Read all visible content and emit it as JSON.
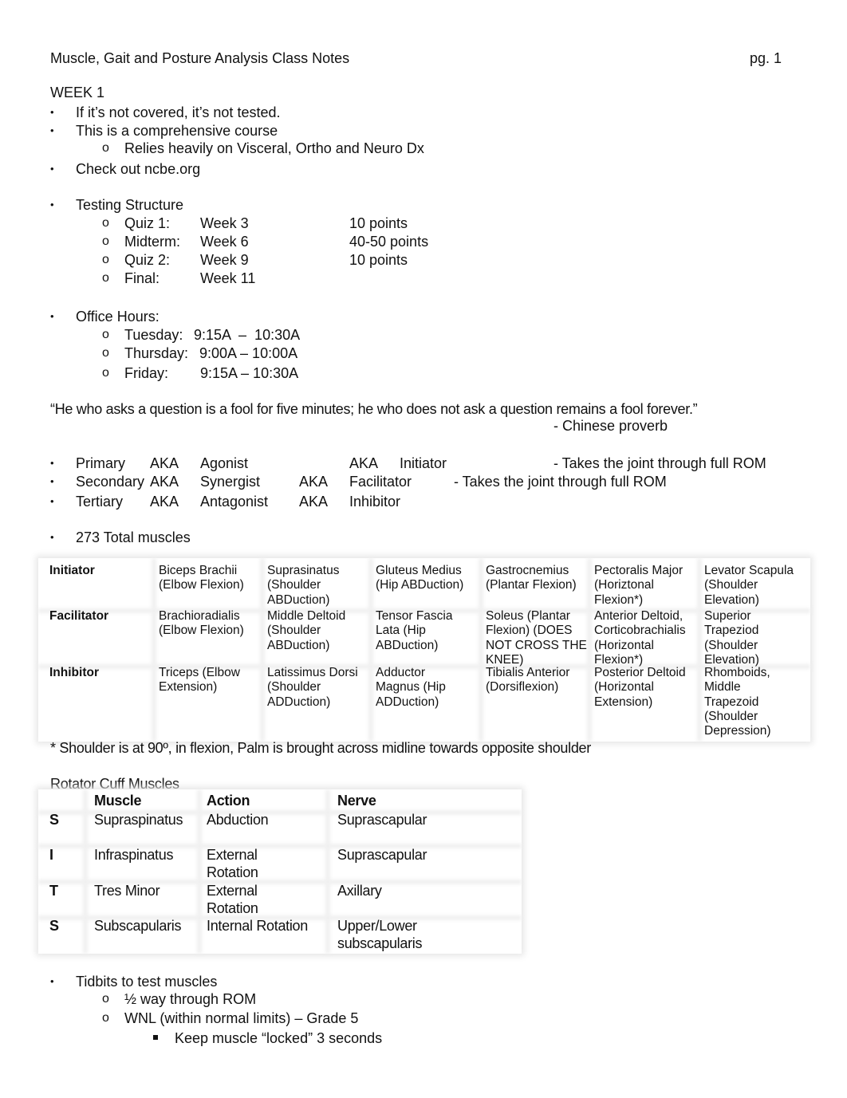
{
  "header": {
    "title": "Muscle, Gait and Posture Analysis Class Notes",
    "page": "pg. 1"
  },
  "week": "WEEK 1",
  "intro_bullets": [
    "If it’s not covered, it’s not tested.",
    "This is a comprehensive course",
    "Check out ncbe.org"
  ],
  "intro_sub": "Relies heavily on Visceral, Ortho and Neuro Dx",
  "testing": {
    "label": "Testing Structure",
    "rows": [
      {
        "name": "Quiz 1:",
        "week": "Week 3",
        "points": "10 points"
      },
      {
        "name": "Midterm:",
        "week": "Week 6",
        "points": "40-50 points"
      },
      {
        "name": "Quiz 2:",
        "week": "Week 9",
        "points": "10 points"
      },
      {
        "name": "Final:",
        "week": "Week 11",
        "points": ""
      }
    ]
  },
  "office_hours": {
    "label": "Office Hours:",
    "rows": [
      {
        "day": "Tuesday:",
        "time": "9:15A  –  10:30A"
      },
      {
        "day": "Thursday:",
        "time": "9:00A – 10:00A"
      },
      {
        "day": "Friday:",
        "time": "9:15A – 10:30A"
      }
    ]
  },
  "quote": {
    "text": "“He who asks a question is a fool for five minutes; he who does not ask a question remains a fool forever.”",
    "attribution": "- Chinese proverb"
  },
  "roles": [
    {
      "a": "Primary",
      "aka1": "AKA",
      "b": "Agonist",
      "aka2": "AKA",
      "c": "Initiator",
      "note": "- Takes the joint through full ROM"
    },
    {
      "a": "Secondary",
      "aka1": "AKA",
      "b": "Synergist",
      "aka2": "AKA",
      "c": "Facilitator",
      "note": "- Takes the joint through full ROM"
    },
    {
      "a": "Tertiary",
      "aka1": "AKA",
      "b": "Antagonist",
      "aka2": "AKA",
      "c": "Inhibitor",
      "note": ""
    }
  ],
  "total_muscles": "273 Total muscles",
  "muscle_table": {
    "rows": [
      {
        "head": "Initiator",
        "cells": [
          "Biceps Brachii (Elbow Flexion)",
          "Suprasinatus (Shoulder ABDuction)",
          "Gluteus Medius (Hip ABDuction)",
          "Gastrocnemius (Plantar Flexion)",
          "Pectoralis Major (Horiztonal Flexion*)",
          "Levator Scapula (Shoulder Elevation)"
        ]
      },
      {
        "head": "Facilitator",
        "cells": [
          "Brachioradialis (Elbow Flexion)",
          "Middle Deltoid (Shoulder ABDuction)",
          "Tensor Fascia Lata (Hip ABDuction)",
          "Soleus (Plantar Flexion) (DOES NOT CROSS THE KNEE)",
          "Anterior Deltoid, Corticobrachialis (Horizontal Flexion*)",
          "Superior Trapeziod (Shoulder Elevation)"
        ]
      },
      {
        "head": "Inhibitor",
        "cells": [
          "Triceps (Elbow Extension)",
          "Latissimus Dorsi (Shoulder ADDuction)",
          "Adductor Magnus (Hip ADDuction)",
          "Tibialis Anterior (Dorsiflexion)",
          "Posterior Deltoid (Horizontal Extension)",
          "Rhomboids, Middle Trapezoid (Shoulder Depression)"
        ]
      }
    ]
  },
  "footnote": "* Shoulder is at 90º, in flexion, Palm is brought across midline towards opposite shoulder",
  "rotator": {
    "title": "Rotator Cuff Muscles",
    "headers": [
      "",
      "Muscle",
      "Action",
      "Nerve"
    ],
    "rows": [
      {
        "letter": "S",
        "muscle": "Supraspinatus",
        "action": "Abduction",
        "nerve": "Suprascapular"
      },
      {
        "letter": "I",
        "muscle": "Infraspinatus",
        "action": "External Rotation",
        "nerve": "Suprascapular"
      },
      {
        "letter": "T",
        "muscle": "Tres Minor",
        "action": "External Rotation",
        "nerve": "Axillary"
      },
      {
        "letter": "S",
        "muscle": "Subscapularis",
        "action": "Internal Rotation",
        "nerve": "Upper/Lower subscapularis"
      }
    ]
  },
  "tidbits": {
    "label": "Tidbits to test muscles",
    "subs": [
      "½ way through ROM",
      "WNL (within normal limits) – Grade 5"
    ],
    "subsub": "Keep muscle “locked” 3 seconds"
  },
  "glyphs": {
    "bullet": "•",
    "sub": "o"
  }
}
